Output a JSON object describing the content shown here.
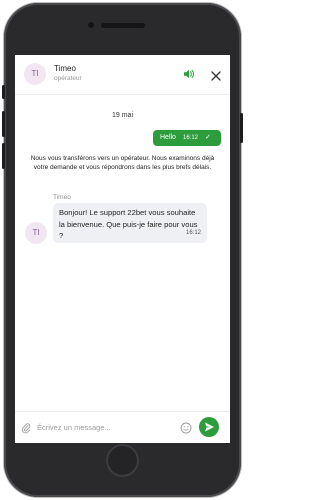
{
  "header": {
    "avatar_initials": "TI",
    "agent_name": "Timeo",
    "agent_role": "opérateur",
    "icons": {
      "sound": "speaker-icon",
      "close": "close-icon"
    }
  },
  "chat": {
    "date": "19 mai",
    "outgoing": {
      "text": "Hello",
      "time": "16:12",
      "status_icon": "check-icon"
    },
    "system_notice": "Nous vous transférons vers un opérateur. Nous examinons déjà votre demande et vous répondrons dans les plus brefs délais.",
    "incoming": {
      "sender": "Timeo",
      "avatar_initials": "TI",
      "text": "Bonjour! Le support 22bet vous souhaite la bienvenue. Que puis-je faire pour vous ?",
      "time": "16:12"
    }
  },
  "composer": {
    "placeholder": "Écrivez un message...",
    "icons": {
      "attach": "paperclip-icon",
      "emoji": "emoji-icon",
      "send": "send-icon"
    }
  },
  "colors": {
    "accent": "#2d9c3d",
    "avatar_bg": "#f1e6f2",
    "avatar_text": "#8a5a9c",
    "incoming_bubble": "#eef0f3"
  }
}
